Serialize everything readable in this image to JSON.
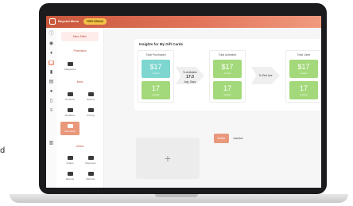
{
  "topbar": {
    "title": "Beyond Menu",
    "pill": "FREE BRAND"
  },
  "sidebar": {
    "group1": "Menu Editor",
    "group2": "Promotions",
    "group3": "Items",
    "group4": "Orders",
    "tiles": [
      {
        "label": "Categories"
      },
      {
        "label": "Products"
      },
      {
        "label": "Options"
      },
      {
        "label": "Modifiers"
      },
      {
        "label": "Pricing"
      },
      {
        "label": "Gift Cards"
      },
      {
        "label": "Orders"
      },
      {
        "label": "Payments"
      },
      {
        "label": "Reports"
      },
      {
        "label": "Refunds"
      }
    ]
  },
  "main": {
    "title": "Insights for My Gift Cards",
    "cards": [
      {
        "head": "Total Purchased",
        "amount_symbol": "$",
        "amount": "17",
        "amount_label": "amount",
        "qty": "17",
        "qty_label": "quantity",
        "top_color": "#7dd6cf",
        "bottom_color": "#a3d97a"
      },
      {
        "head": "Total Activated",
        "amount_symbol": "$",
        "amount": "17",
        "amount_label": "amount",
        "qty": "17",
        "qty_label": "quantity",
        "top_color": "#a3d97a",
        "bottom_color": "#a3d97a"
      },
      {
        "head": "Total Used",
        "amount_symbol": "$",
        "amount": "17",
        "amount_label": "amount",
        "qty": "17",
        "qty_label": "quantity",
        "top_color": "#a3d97a",
        "bottom_color": "#a3d97a"
      }
    ],
    "arrow1": {
      "label": "To Activation",
      "value": "17.0",
      "sub": "Avg. Days"
    },
    "arrow2": {
      "label": "To First Use"
    }
  },
  "toggles": {
    "active": "Active",
    "inactive": "Inactive"
  },
  "add_tile": {
    "symbol": "+"
  },
  "stray_char": "d",
  "colors": {
    "accent": "#e2745a",
    "green": "#a3d97a",
    "teal": "#7dd6cf"
  }
}
